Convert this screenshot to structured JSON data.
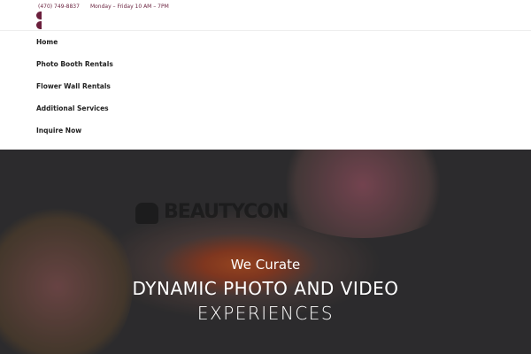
{
  "topbar": {
    "phone": "(470) 749-8837",
    "hours": "Monday – Friday 10 AM – 7PM"
  },
  "nav": {
    "items": [
      {
        "label": "Home"
      },
      {
        "label": "Photo Booth Rentals"
      },
      {
        "label": "Flower Wall Rentals"
      },
      {
        "label": "Additional Services"
      },
      {
        "label": "Inquire Now"
      }
    ]
  },
  "hero": {
    "backdrop_text": "BEAUTYCON",
    "line1": "We Curate",
    "line2": "DYNAMIC PHOTO AND VIDEO",
    "line3": "EXPERIENCES"
  },
  "colors": {
    "brand": "#6b1f3c"
  }
}
